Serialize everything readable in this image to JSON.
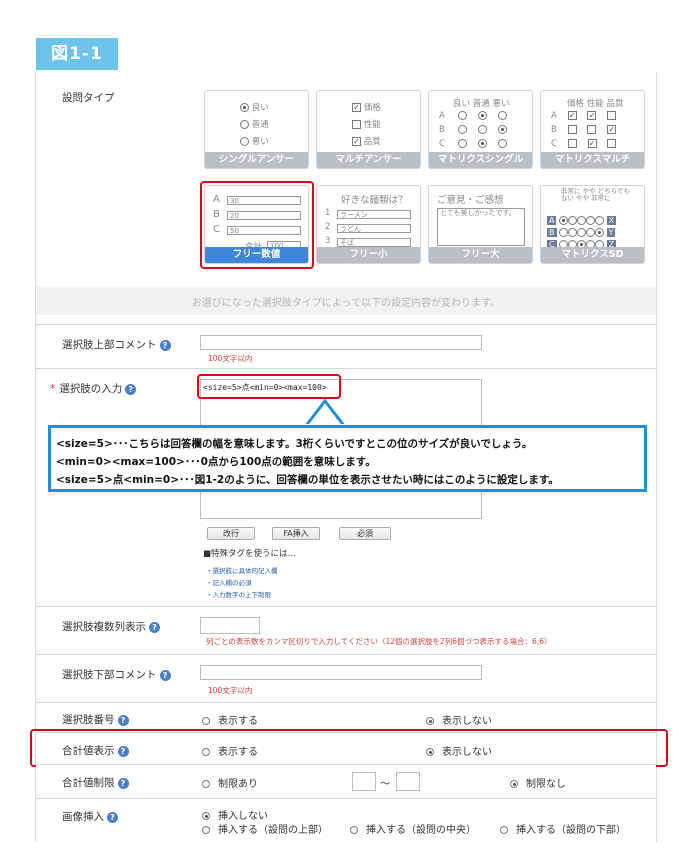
{
  "figure_label": "図1-1",
  "question_type": {
    "label": "設問タイプ",
    "cards": [
      {
        "caption": "シングルアンサー",
        "options": [
          "良い",
          "普通",
          "悪い"
        ]
      },
      {
        "caption": "マルチアンサー",
        "options": [
          "価格",
          "性能",
          "品質"
        ]
      },
      {
        "caption": "マトリクスシングル",
        "cols": [
          "良い",
          "普通",
          "悪い"
        ],
        "rows": [
          "A",
          "B",
          "C"
        ]
      },
      {
        "caption": "マトリクスマルチ",
        "cols": [
          "価格",
          "性能",
          "品質"
        ],
        "rows": [
          "A",
          "B",
          "C"
        ]
      },
      {
        "caption": "フリー数値",
        "rows": [
          "A",
          "B",
          "C"
        ],
        "values": [
          "30",
          "20",
          "50"
        ],
        "total_label": "合計",
        "total": "100"
      },
      {
        "caption": "フリー小",
        "title": "好きな麺類は？",
        "rows": [
          "1",
          "2",
          "3"
        ],
        "values": [
          "ラーメン",
          "うどん",
          "そば"
        ]
      },
      {
        "caption": "フリー大",
        "title": "ご意見・ご感想",
        "value": "とても美しかったです。"
      },
      {
        "caption": "マトリクスSD",
        "rows": [
          "A",
          "B",
          "C"
        ],
        "right": [
          "X",
          "Y",
          "Z"
        ],
        "cols": [
          "非常に",
          "やや",
          "どちらでもない",
          "やや",
          "非常に"
        ]
      }
    ],
    "note": "お選びになった選択肢タイプによって以下の設定内容が変わります。"
  },
  "choice_top_comment": {
    "label": "選択肢上部コメント",
    "hint": "100文字以内"
  },
  "choice_input": {
    "label": "選択肢の入力",
    "required_mark": "*",
    "value": "<size=5>点<min=0><max=100>",
    "buttons": [
      "改行",
      "FA挿入",
      "必須"
    ],
    "special_tag_title": "■特殊タグを使うには…",
    "special_tag_links": [
      "・選択肢に具体的記入欄",
      "・記入欄の必須",
      "・入力数字の上下制限"
    ]
  },
  "callout": {
    "lines": [
      "<size=5>･･･こちらは回答欄の幅を意味します。3桁くらいですとこの位のサイズが良いでしょう。",
      "<min=0><max=100>･･･0点から100点の範囲を意味します。",
      "<size=5>点<min=0>･･･図1-2のように、回答欄の単位を表示させたい時にはこのように設定します。"
    ]
  },
  "multi_column": {
    "label": "選択肢複数列表示",
    "hint": "列ごとの表示数をカンマ区切りで入力してください（12個の選択肢を2列6個づつ表示する場合：6,6）"
  },
  "choice_bottom_comment": {
    "label": "選択肢下部コメント",
    "hint": "100文字以内"
  },
  "choice_number": {
    "label": "選択肢番号",
    "options": [
      "表示する",
      "表示しない"
    ],
    "selected": 1
  },
  "total_display": {
    "label": "合計値表示",
    "options": [
      "表示する",
      "表示しない"
    ],
    "selected": 1
  },
  "total_limit": {
    "label": "合計値制限",
    "options": [
      "制限あり",
      "制限なし"
    ],
    "separator": "～",
    "selected": 1
  },
  "image_insert": {
    "label": "画像挿入",
    "options": [
      "挿入しない",
      "挿入する（設問の上部）",
      "挿入する（設問の中央）",
      "挿入する（設問の下部）"
    ],
    "selected": 0
  },
  "colors": {
    "accent": "#3f86d8",
    "highlight": "#d40d1d",
    "callout": "#1b8fd8",
    "figtag": "#6ec3ea"
  }
}
